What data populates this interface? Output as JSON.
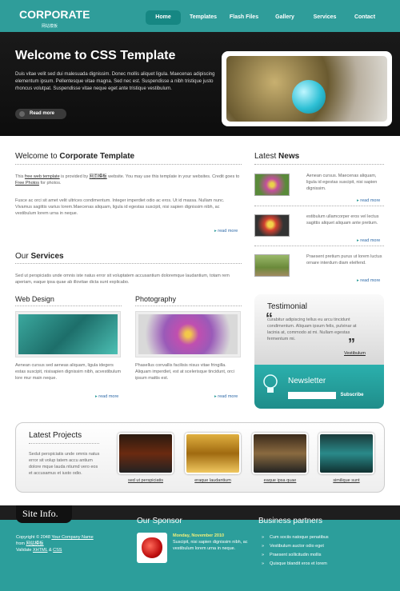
{
  "header": {
    "logo": "CORPORATE",
    "logo_sub": "网站模板",
    "nav": [
      "Home",
      "Templates",
      "Flash Files",
      "Gallery",
      "Services",
      "Contact"
    ]
  },
  "hero": {
    "title": "Welcome to CSS Template",
    "text": "Duis vitae velit sed dui malesuada dignissim. Donec mollis aliquet ligula. Maecenas adipiscing elementum ipsum. Pellentesque vitae magna. Sed nec est. Suspendisse a nibh tristique justo rhoncus volutpat. Suspendisse vitae neque eget ante tristique vestibulum.",
    "button": "Read more"
  },
  "welcome": {
    "title_prefix": "Welcome to ",
    "title_bold": "Corporate Template",
    "p1_a": "This ",
    "p1_link1": "free web template",
    "p1_b": " is provided by ",
    "p1_link2": "网页模板",
    "p1_c": " website. You may use this template in your websites. Credit goes to ",
    "p1_link3": "Free Photos",
    "p1_d": " for photos.",
    "p2": "Fusce ac orci sit amet velit ultrices condimentum. Integer imperdiet odio ac eros. Ut id massa. Nullam nunc. Vivamus sagittis varius lorem.Maecenas aliquam, ligula id egestas suscipit, nisi sapien dignissim nibh, ac vestibulum lorem urna in neque.",
    "more": "read more"
  },
  "services": {
    "title_prefix": "Our ",
    "title_bold": "Services",
    "text": "Sed ut perspiciatis unde omnis iste natus error sit voluptatem accusantium doloremque laudantium, totam rem aperiam, eaque ipsa quae ab illovitae dicta sunt explicabo.",
    "web_title": "Web Design",
    "web_text": "Aenean cursus sed aeneas aliquam, ligula idegers estas suscipit, nisisapien dignissim nibh, acvestibulum lore mur main neque.",
    "photo_title": "Photography",
    "photo_text": "Phasellus convallis facilisis nisus vitae fringilla. Aliquam imperdiet, est at scelerisque tincidunt, orci ipsum mattis est.",
    "more": "read more"
  },
  "news": {
    "title_prefix": "Latest ",
    "title_bold": "News",
    "items": [
      "Aenean cursus. Maecenas aliquam, ligula id egestas suscipit, nisi sapien dignissim.",
      "estibulum ullamcorper eros vel lectus sagittis aliquet aliquam ante pretium.",
      "Praesent pretium purus ut lorem luctus ornare interdum diam eleifend."
    ],
    "more": "read more"
  },
  "testimonial": {
    "title": "Testimonial",
    "text": "curabitur adipiscing tellus eu arcu tincidunt condimentum. Aliquam ipsum felis, pulvinar at lacinia at, commodo at mi. Nullam egestas fermentum mi.",
    "author": "Vestibulum"
  },
  "newsletter": {
    "title": "Newsletter",
    "button": "Subscribe"
  },
  "projects": {
    "title": "Latest Projects",
    "text": "Sedut perspiciatis unde omnis natus error sit volup tatem accu antium dolore mque lauda ntiumd vero eos et accusamus et iusto odio.",
    "items": [
      "sed ut perspiciatis",
      "eraque laudantium",
      "eaque ipsa quae",
      "similique sunt"
    ]
  },
  "footer": {
    "site_info": "Site Info.",
    "copyright_a": "Copyright © 2048 ",
    "copyright_link": "Your Company Name",
    "from_a": "from ",
    "from_link": "网站模板",
    "validate_a": "Validate ",
    "validate_xhtml": "XHTML",
    "validate_and": " & ",
    "validate_css": "CSS",
    "sponsor_title": "Our Sponsor",
    "sponsor_date": "Monday, November 2010",
    "sponsor_text": "Suscipit, nisi sapien dignissim nibh, ac vestibulum lorem urna in neque.",
    "partners_title": "Business partners",
    "partners": [
      "Cum sociis natoque penatibus",
      "Vestibulum auctor odio eget",
      "Praesent sollicitudin mollis",
      "Quisque blandit eros et lorem"
    ]
  },
  "colors": {
    "accent": "#2f9d9a",
    "nav_active": "#168783",
    "link": "#2e6aa8"
  }
}
